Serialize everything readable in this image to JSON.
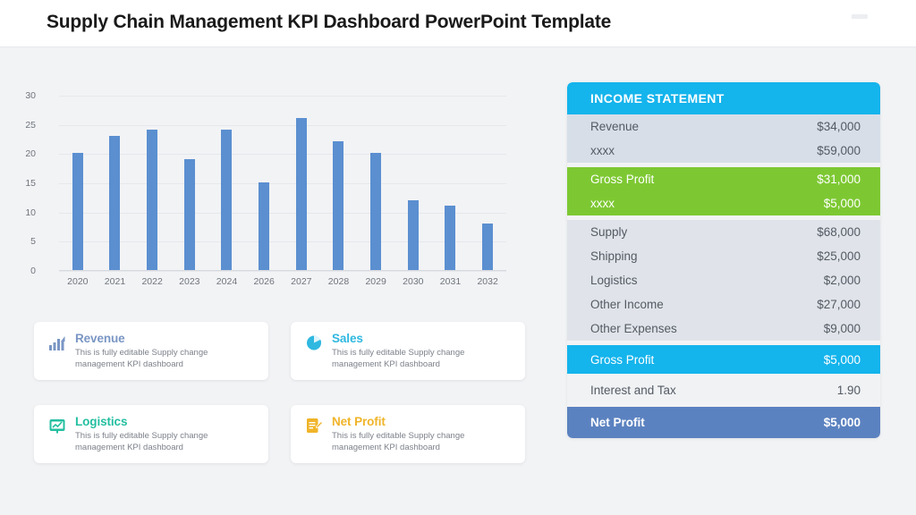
{
  "header": {
    "title": "Supply Chain Management KPI Dashboard PowerPoint Template"
  },
  "chart_data": {
    "type": "bar",
    "title": "",
    "xlabel": "",
    "ylabel": "",
    "categories": [
      "2020",
      "2021",
      "2022",
      "2023",
      "2024",
      "2026",
      "2027",
      "2028",
      "2029",
      "2030",
      "2031",
      "2032"
    ],
    "values": [
      20,
      23,
      24,
      19,
      24,
      15,
      26,
      22,
      20,
      12,
      11,
      8
    ],
    "ylim": [
      0,
      30
    ],
    "yticks": [
      30,
      25,
      20,
      15,
      10,
      5,
      0
    ],
    "grid": true,
    "legend": "none",
    "bar_color": "#5b8fd0"
  },
  "kpi_cards": [
    {
      "name": "revenue",
      "title": "Revenue",
      "description": "This is fully editable Supply change management KPI dashboard",
      "color": "#7a96c4",
      "icon": "bar-chart-growth-icon"
    },
    {
      "name": "sales",
      "title": "Sales",
      "description": "This is fully editable Supply change management KPI dashboard",
      "color": "#2fb8e0",
      "icon": "pie-chart-icon"
    },
    {
      "name": "logistics",
      "title": "Logistics",
      "description": "This is fully editable Supply change management KPI dashboard",
      "color": "#23bfa0",
      "icon": "presentation-chart-icon"
    },
    {
      "name": "net-profit",
      "title": "Net Profit",
      "description": "This is fully editable Supply change management KPI dashboard",
      "color": "#f0b429",
      "icon": "document-edit-icon"
    }
  ],
  "income_statement": {
    "header": "INCOME STATEMENT",
    "header_color": "#14b4ec",
    "blocks": [
      {
        "style": "blk-a",
        "rows": [
          {
            "label": "Revenue",
            "value": "$34,000"
          },
          {
            "label": "xxxx",
            "value": "$59,000"
          }
        ]
      },
      {
        "style": "blk-green",
        "rows": [
          {
            "label": "Gross Profit",
            "value": "$31,000"
          },
          {
            "label": "xxxx",
            "value": "$5,000"
          }
        ]
      },
      {
        "style": "blk-b",
        "rows": [
          {
            "label": "Supply",
            "value": "$68,000"
          },
          {
            "label": "Shipping",
            "value": "$25,000"
          },
          {
            "label": "Logistics",
            "value": "$2,000"
          },
          {
            "label": "Other Income",
            "value": "$27,000"
          },
          {
            "label": "Other Expenses",
            "value": "$9,000"
          }
        ]
      },
      {
        "style": "blk-cyan",
        "rows": [
          {
            "label": "Gross Profit",
            "value": "$5,000"
          }
        ]
      },
      {
        "style": "blk-c",
        "rows": [
          {
            "label": "Interest and Tax",
            "value": "1.90"
          }
        ]
      },
      {
        "style": "blk-navy",
        "rows": [
          {
            "label": "Net Profit",
            "value": "$5,000"
          }
        ]
      }
    ]
  }
}
